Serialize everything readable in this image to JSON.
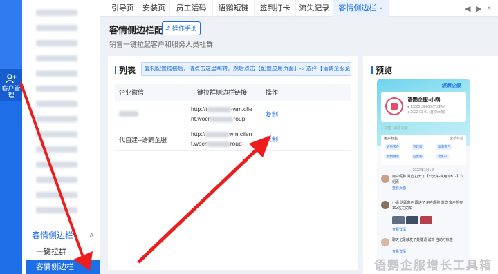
{
  "rail": {
    "item_label": "客户管理",
    "icon": "add-user-icon"
  },
  "sidebar": {
    "group_label": "客情侧边栏",
    "items": [
      {
        "label": "一键拉群"
      },
      {
        "label": "客情侧边栏"
      }
    ]
  },
  "tabs": [
    {
      "label": "引导页"
    },
    {
      "label": "安装页"
    },
    {
      "label": "员工活码"
    },
    {
      "label": "语鹦短链"
    },
    {
      "label": "签到打卡"
    },
    {
      "label": "流失记录"
    },
    {
      "label": "客情侧边栏",
      "close": "×"
    }
  ],
  "window_controls": {
    "prev": "◀",
    "next": "▶",
    "close": "×"
  },
  "page": {
    "title": "客情侧边栏配置",
    "manual_button": "⇵ 操作手册",
    "subtitle": "销售一键拉起客户和服务人员社群"
  },
  "list": {
    "title": "列表",
    "notice": "复制配置链接后，请点击这里跳转，然后点击【配置应用页面】-> 选择【语鹦企服企业助手】",
    "columns": [
      "企业微信",
      "一键拉群侧边栏链接",
      "操作"
    ],
    "rows": [
      {
        "corp": "",
        "link_start": "http://t",
        "link_mid": "-wm.clie",
        "link_line2_start": "nt.wocr",
        "link_end": "roup",
        "action": "复制"
      },
      {
        "corp": "代自建--语鹦企服",
        "link_start": "http://",
        "link_mid": "wm.clien",
        "link_line2_start": "t.wocr",
        "link_end": "roup",
        "action": "复制"
      }
    ]
  },
  "preview": {
    "title": "预览",
    "brand": "语鹦企服",
    "profile_name": "语鹦企服-小鹉",
    "profile_lines": [
      "● 13000138000 (已成功)",
      "● 2022-01-01 (首次添加)"
    ],
    "bar_text": "● 标签 · 跟进记录",
    "tag_title": "用户标签",
    "tag_all": "全部标签",
    "tags": [
      "会员客户",
      "活跃客",
      "高潜客户",
      "营销触达",
      "已复购",
      "老客户",
      "有价值用户"
    ],
    "date": "2022年1月1日",
    "events": [
      {
        "text": "用户昵称 浏览 打开了【公交车-纯电动B12】介绍页",
        "link": "查看页面"
      },
      {
        "text": "小清 活跃客户 跟进了 用户昵称 浏览 客户想买10w左右的车",
        "link": "查看详情"
      },
      {
        "text": "聊天记录触发了关键词 试驾 自动打标签",
        "link": "查看详情"
      }
    ]
  },
  "watermark": "语鹦企服增长工具箱"
}
